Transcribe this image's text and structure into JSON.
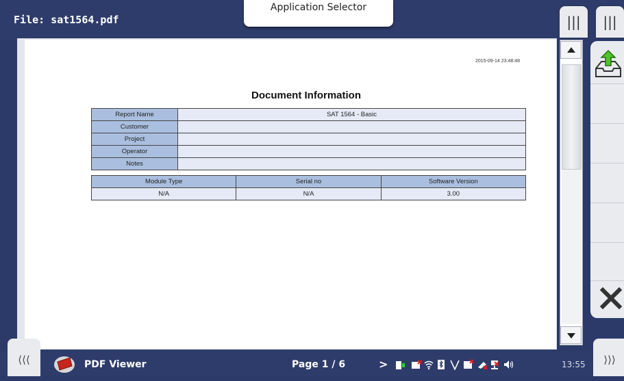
{
  "header": {
    "file_title": "File: sat1564.pdf",
    "app_selector_label": "Application Selector"
  },
  "document": {
    "timestamp": "2015-09-14 23:48:48",
    "heading": "Document Information",
    "info_rows": [
      {
        "key": "Report Name",
        "value": "SAT 1564 - Basic"
      },
      {
        "key": "Customer",
        "value": ""
      },
      {
        "key": "Project",
        "value": ""
      },
      {
        "key": "Operator",
        "value": ""
      },
      {
        "key": "Notes",
        "value": ""
      }
    ],
    "module_headers": [
      "Module Type",
      "Serial no",
      "Software Version"
    ],
    "module_values": [
      "N/A",
      "N/A",
      "3.00"
    ]
  },
  "footer": {
    "app_name": "PDF Viewer",
    "page_indicator": "Page 1 / 6",
    "status_arrow": ">",
    "clock": "13:55"
  },
  "colors": {
    "frame": "#2e3c6b",
    "table_header": "#aabfdf",
    "table_cell": "#e6eaf6",
    "panel": "#e9ebef"
  }
}
